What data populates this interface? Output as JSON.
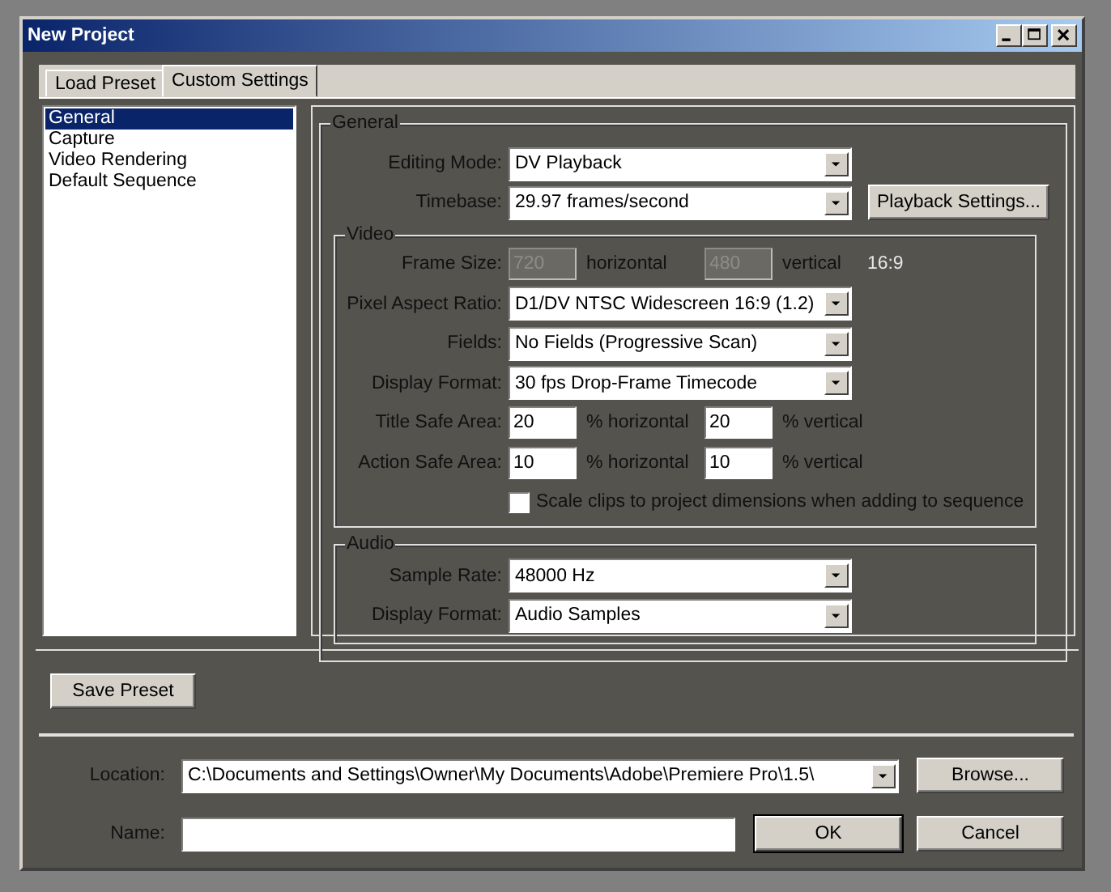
{
  "window": {
    "title": "New Project"
  },
  "tabs": [
    {
      "label": "Load Preset",
      "selected": false
    },
    {
      "label": "Custom Settings",
      "selected": true
    }
  ],
  "sidebar": {
    "items": [
      {
        "label": "General",
        "selected": true
      },
      {
        "label": "Capture",
        "selected": false
      },
      {
        "label": "Video Rendering",
        "selected": false
      },
      {
        "label": "Default Sequence",
        "selected": false
      }
    ]
  },
  "general": {
    "title": "General",
    "rows": [
      {
        "kind": "select",
        "label": "Editing Mode:",
        "value": "DV Playback"
      },
      {
        "kind": "select",
        "label": "Timebase:",
        "value": "29.97 frames/second",
        "button": "Playback Settings..."
      }
    ]
  },
  "video": {
    "title": "Video",
    "rows": [
      {
        "kind": "pair",
        "label": "Frame Size:",
        "disabled": true,
        "fields": [
          {
            "value": "720",
            "unit": "horizontal"
          },
          {
            "value": "480",
            "unit": "vertical"
          }
        ],
        "note": "16:9"
      },
      {
        "kind": "select",
        "label": "Pixel Aspect Ratio:",
        "value": "D1/DV NTSC Widescreen 16:9 (1.2)"
      },
      {
        "kind": "select",
        "label": "Fields:",
        "value": "No Fields (Progressive Scan)"
      },
      {
        "kind": "select",
        "label": "Display Format:",
        "value": "30 fps Drop-Frame Timecode"
      },
      {
        "kind": "pair",
        "label": "Title Safe Area:",
        "disabled": false,
        "fields": [
          {
            "value": "20",
            "unit": "% horizontal"
          },
          {
            "value": "20",
            "unit": "% vertical"
          }
        ]
      },
      {
        "kind": "pair",
        "label": "Action Safe Area:",
        "disabled": false,
        "fields": [
          {
            "value": "10",
            "unit": "% horizontal"
          },
          {
            "value": "10",
            "unit": "% vertical"
          }
        ]
      },
      {
        "kind": "check",
        "label": "Scale clips to project dimensions when adding to sequence",
        "checked": false
      }
    ]
  },
  "audio": {
    "title": "Audio",
    "rows": [
      {
        "kind": "select",
        "label": "Sample Rate:",
        "value": "48000 Hz"
      },
      {
        "kind": "select",
        "label": "Display Format:",
        "value": "Audio Samples"
      }
    ]
  },
  "save_preset_button": "Save Preset",
  "location": {
    "label": "Location:",
    "value": "C:\\Documents and Settings\\Owner\\My Documents\\Adobe\\Premiere Pro\\1.5\\",
    "button": "Browse..."
  },
  "name": {
    "label": "Name:"
  },
  "buttons": [
    {
      "label": "OK",
      "default": true
    },
    {
      "label": "Cancel",
      "default": false
    }
  ]
}
